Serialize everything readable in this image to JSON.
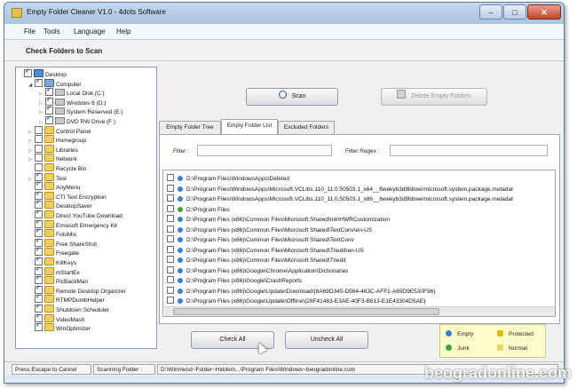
{
  "window": {
    "title": "Empty Folder Cleaner V1.0 - 4dots Software"
  },
  "menu": [
    "File",
    "Tools",
    "Language",
    "Help"
  ],
  "header": {
    "title": "Check Folders to Scan"
  },
  "tree": [
    {
      "label": "Desktop",
      "level": 0,
      "icon": "desktop-icon",
      "checked": true,
      "expander": ""
    },
    {
      "label": "Computer",
      "level": 1,
      "icon": "computer-icon",
      "checked": true,
      "expander": "◢"
    },
    {
      "label": "Local Disk (C:)",
      "level": 2,
      "icon": "drive-icon",
      "checked": true,
      "expander": "▷"
    },
    {
      "label": "Windows 8 (D:)",
      "level": 2,
      "icon": "drive-icon",
      "checked": true,
      "expander": "▷"
    },
    {
      "label": "System Reserved (E:)",
      "level": 2,
      "icon": "drive-icon",
      "checked": true,
      "expander": "▷"
    },
    {
      "label": "DVD RW Drive (F:)",
      "level": 2,
      "icon": "drive-icon",
      "checked": true,
      "expander": "▷"
    },
    {
      "label": "Control Panel",
      "level": 1,
      "icon": "folder-icon",
      "checked": false,
      "expander": "▷"
    },
    {
      "label": "Homegroup",
      "level": 1,
      "icon": "folder-icon",
      "checked": false,
      "expander": "▷"
    },
    {
      "label": "Libraries",
      "level": 1,
      "icon": "folder-icon",
      "checked": false,
      "expander": "▷"
    },
    {
      "label": "Network",
      "level": 1,
      "icon": "folder-icon",
      "checked": false,
      "expander": "▷"
    },
    {
      "label": "Recycle Bin",
      "level": 1,
      "icon": "folder-icon",
      "checked": false,
      "expander": ""
    },
    {
      "label": "Test",
      "level": 1,
      "icon": "folder-icon",
      "checked": true,
      "expander": "▷"
    },
    {
      "label": "AnyMenu",
      "level": 1,
      "icon": "folder-icon",
      "checked": true,
      "expander": ""
    },
    {
      "label": "CTI Text Encryption",
      "level": 1,
      "icon": "folder-icon",
      "checked": true,
      "expander": ""
    },
    {
      "label": "DesktopSaver",
      "level": 1,
      "icon": "folder-icon",
      "checked": true,
      "expander": ""
    },
    {
      "label": "Direct YouTube Download",
      "level": 1,
      "icon": "folder-icon",
      "checked": true,
      "expander": ""
    },
    {
      "label": "Emsisoft Emergency Kit",
      "level": 1,
      "icon": "folder-icon",
      "checked": true,
      "expander": ""
    },
    {
      "label": "FotoMix",
      "level": 1,
      "icon": "folder-icon",
      "checked": true,
      "expander": ""
    },
    {
      "label": "Free ShareShot",
      "level": 1,
      "icon": "folder-icon",
      "checked": true,
      "expander": ""
    },
    {
      "label": "Freegate",
      "level": 1,
      "icon": "folder-icon",
      "checked": true,
      "expander": ""
    },
    {
      "label": "KillKeys",
      "level": 1,
      "icon": "folder-icon",
      "checked": true,
      "expander": ""
    },
    {
      "label": "mStartEx",
      "level": 1,
      "icon": "folder-icon",
      "checked": true,
      "expander": ""
    },
    {
      "label": "PicBackMan",
      "level": 1,
      "icon": "folder-icon",
      "checked": true,
      "expander": ""
    },
    {
      "label": "Remote Desktop Organizer",
      "level": 1,
      "icon": "folder-icon",
      "checked": true,
      "expander": ""
    },
    {
      "label": "RTMPDumbHelper",
      "level": 1,
      "icon": "folder-icon",
      "checked": true,
      "expander": ""
    },
    {
      "label": "Shutdown Scheduler",
      "level": 1,
      "icon": "folder-icon",
      "checked": true,
      "expander": ""
    },
    {
      "label": "VideoMash",
      "level": 1,
      "icon": "folder-icon",
      "checked": true,
      "expander": ""
    },
    {
      "label": "WinOptimizer",
      "level": 1,
      "icon": "folder-icon",
      "checked": true,
      "expander": ""
    }
  ],
  "buttons": {
    "scan": "Scan",
    "delete": "Delete Empty Folders",
    "check_all": "Check All",
    "uncheck_all": "Uncheck All"
  },
  "tabs": [
    "Empty Folder Tree",
    "Empty Folder List",
    "Excluded Folders"
  ],
  "filter": {
    "label": "Filter :",
    "regex_label": "Filter Regex :",
    "value": "",
    "regex_value": ""
  },
  "list": [
    {
      "path": "D:\\Program Files\\WindowsApps\\Deleted",
      "status": "empty"
    },
    {
      "path": "D:\\Program Files\\WindowsApps\\Microsoft.VCLibs.110_11.0.50503.1_x64__8wekyb3d8bbwe\\microsoft.system.package.metadat",
      "status": "empty"
    },
    {
      "path": "D:\\Program Files\\WindowsApps\\Microsoft.VCLibs.110_11.0.50503.1_x86__8wekyb3d8bbwe\\microsoft.system.package.metadat",
      "status": "empty"
    },
    {
      "path": "D:\\Program Files",
      "status": "junk"
    },
    {
      "path": "D:\\Program Files (x86)\\Common Files\\Microsoft Shared\\Ink\\HWRCustomization",
      "status": "empty"
    },
    {
      "path": "D:\\Program Files (x86)\\Common Files\\Microsoft Shared\\TextConv\\en-US",
      "status": "empty"
    },
    {
      "path": "D:\\Program Files (x86)\\Common Files\\Microsoft Shared\\TextConv",
      "status": "empty"
    },
    {
      "path": "D:\\Program Files (x86)\\Common Files\\Microsoft Shared\\Triedit\\en-US",
      "status": "empty"
    },
    {
      "path": "D:\\Program Files (x86)\\Common Files\\Microsoft Shared\\Triedit",
      "status": "empty"
    },
    {
      "path": "D:\\Program Files (x86)\\Google\\Chrome\\Application\\Dictionaries",
      "status": "empty"
    },
    {
      "path": "D:\\Program Files (x86)\\Google\\CrashReports",
      "status": "empty"
    },
    {
      "path": "D:\\Program Files (x86)\\Google\\Update\\Download\\{8A69D345-D564-463C-AFF1-A69D9E530F96}",
      "status": "empty"
    },
    {
      "path": "D:\\Program Files (x86)\\Google\\Update\\Offline\\{28F41463-E3AE-40F3-B613-E1E43304D5AE}",
      "status": "empty"
    }
  ],
  "legend": {
    "empty": "Empty",
    "protected": "Protected",
    "junk": "Junk",
    "normal": "Normal"
  },
  "status": {
    "escape": "Press Escape to Cancel",
    "scanning_label": "Scanning Folder :",
    "scanning_path": "D:\\Winmend~Folder~Hidden\\...\\Program Files\\Windows~beogradonline.com"
  },
  "watermark": "beogradonline.com",
  "colors": {
    "empty": "#3b7fd4",
    "junk": "#3aa33a",
    "protected": "#e6b800",
    "normal": "#e9d46b"
  }
}
